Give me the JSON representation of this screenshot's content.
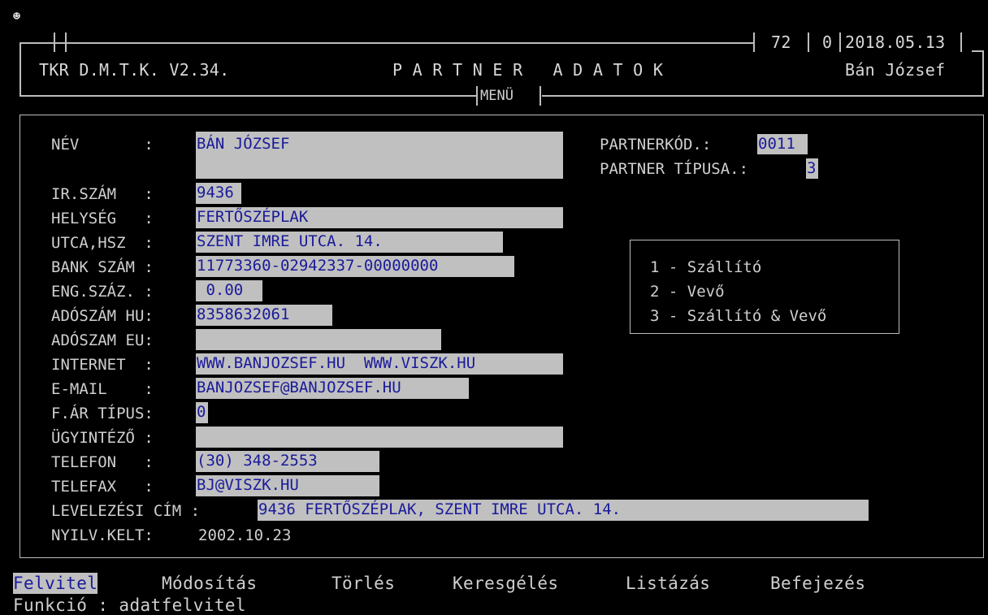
{
  "top_icon": "☻",
  "header": {
    "app": "TKR D.M.T.K. V2.34.",
    "title": "P A R T N E R   A D A T O K",
    "num1": "72",
    "num2": "0",
    "date": "2018.05.13",
    "user": "Bán József",
    "menu_tab": "MENÜ"
  },
  "form": {
    "labels": {
      "nev": "NÉV       :",
      "irszam": "IR.SZÁM   :",
      "helyseg": "HELYSÉG   :",
      "utca": "UTCA,HSZ  :",
      "bank": "BANK SZÁM :",
      "eng": "ENG.SZÁZ. :",
      "adohu": "ADÓSZÁM HU:",
      "adoeu": "ADÓSZAM EU:",
      "internet": "INTERNET  :",
      "email": "E-MAIL    :",
      "far": "F.ÁR TÍPUS:",
      "ugyintezo": "ÜGYINTÉZŐ :",
      "telefon": "TELEFON   :",
      "telefax": "TELEFAX   :",
      "levelezesi": "LEVELEZÉSI CÍM :",
      "nyilv": "NYILV.KELT:",
      "partnerkod": "PARTNERKÓD.:",
      "partnertipus": "PARTNER TÍPUSA.:"
    },
    "values": {
      "nev": "BÁN JÓZSEF",
      "nev2": "",
      "irszam": "9436",
      "helyseg": "FERTŐSZÉPLAK",
      "utca": "SZENT IMRE UTCA. 14.",
      "bank": "11773360-02942337-00000000",
      "eng": " 0.00",
      "adohu": "8358632061",
      "adoeu": "",
      "internet": "WWW.BANJOZSEF.HU  WWW.VISZK.HU",
      "email": "BANJOZSEF@BANJOZSEF.HU",
      "far": "0",
      "ugyintezo": "",
      "telefon": "(30) 348-2553",
      "telefax": "BJ@VISZK.HU",
      "levelezesi": "9436 FERTŐSZÉPLAK, SZENT IMRE UTCA. 14.",
      "nyilv": "2002.10.23",
      "partnerkod": "0011",
      "partnertipus": "3"
    }
  },
  "type_legend": [
    "1 - Szállító",
    "2 - Vevő",
    "3 - Szállító & Vevő"
  ],
  "menu": [
    "Felvitel",
    "Módosítás",
    "Törlés",
    "Keresgélés",
    "Listázás",
    "Befejezés"
  ],
  "status": "Funkció : adatfelvitel"
}
